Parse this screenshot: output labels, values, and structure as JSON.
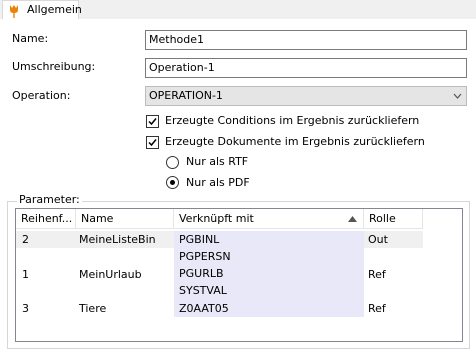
{
  "tab": {
    "label": "Allgemein"
  },
  "form": {
    "name_label": "Name:",
    "name_value": "Methode1",
    "umschreibung_label": "Umschreibung:",
    "umschreibung_value": "Operation-1",
    "operation_label": "Operation:",
    "operation_value": "OPERATION-1",
    "checkbox_conditions": {
      "label": "Erzeugte Conditions im Ergebnis zurückliefern",
      "checked": true
    },
    "checkbox_dokumente": {
      "label": "Erzeugte Dokumente im Ergebnis zurückliefern",
      "checked": true
    },
    "radio_rtf": {
      "label": "Nur als RTF",
      "selected": false
    },
    "radio_pdf": {
      "label": "Nur als PDF",
      "selected": true
    }
  },
  "parameter": {
    "group_label": "Parameter:",
    "columns": [
      "Reihenf...",
      "Name",
      "Verknüpft mit",
      "Rolle"
    ],
    "rows": [
      {
        "order": "2",
        "name": "MeineListeBin",
        "linked": [
          "PGBINL"
        ],
        "role": "Out"
      },
      {
        "order": "1",
        "name": "MeinUrlaub",
        "linked": [
          "PGPERSN",
          "PGURLB",
          "SYSTVAL"
        ],
        "role": "Ref"
      },
      {
        "order": "3",
        "name": "Tiere",
        "linked": [
          "Z0AAT05"
        ],
        "role": "Ref"
      }
    ]
  },
  "colors": {
    "accent": "#e8830c",
    "link_bg": "#e8e8f8",
    "border": "#7a7a7a"
  },
  "icons": {
    "tab_icon": "tulip-icon",
    "combo_icon": "chevron-down-icon",
    "sort_icon": "sort-ascending-icon"
  }
}
